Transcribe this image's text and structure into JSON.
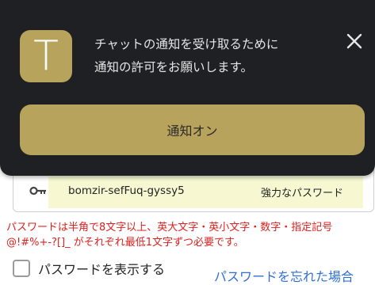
{
  "notification": {
    "app_icon_letter": "T",
    "message_line1": "チャットの通知を受け取るために",
    "message_line2": "通知の許可をお願いします。",
    "enable_button_label": "通知オン",
    "close_icon": "close-icon",
    "accent_color": "#b8a35c"
  },
  "password_field": {
    "icon": "key-icon",
    "value": "bomzir-sefFuq-gyssy5",
    "strength_label": "強力なパスワード"
  },
  "requirements": {
    "text": "パスワードは半角で8文字以上、英大文字・英小文字・数字・指定記号 @!#%+-?[]_ がそれぞれ最低1文字ずつ必要です。",
    "color": "#e0201d"
  },
  "show_password": {
    "label": "パスワードを表示する",
    "checked": false
  },
  "forgot_password": {
    "label": "パスワードを忘れた場合",
    "color": "#2f6fd6"
  }
}
